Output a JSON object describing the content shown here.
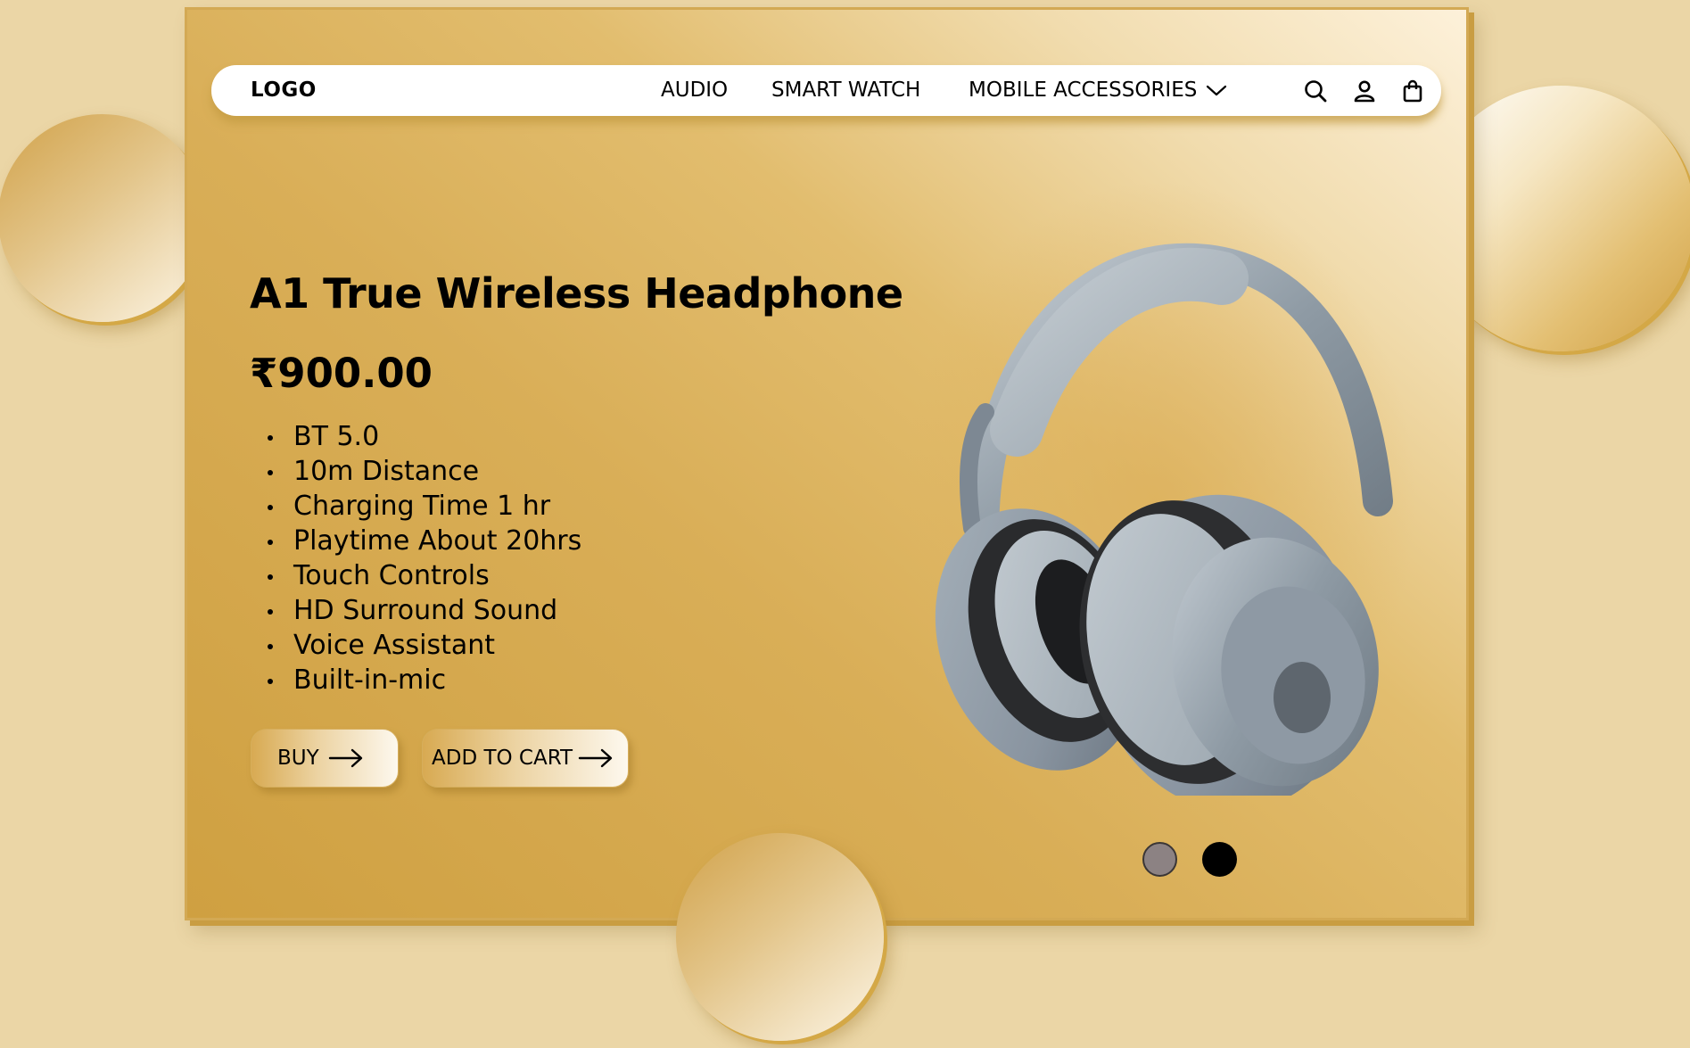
{
  "navbar": {
    "logo": "LOGO",
    "links": [
      "AUDIO",
      "SMART WATCH",
      "MOBILE ACCESSORIES"
    ],
    "icons": [
      "search-icon",
      "user-icon",
      "shopping-bag-icon"
    ]
  },
  "product": {
    "title": "A1 True Wireless Headphone",
    "price": "₹900.00",
    "features": [
      "BT 5.0",
      "10m Distance",
      "Charging Time 1 hr",
      "Playtime About 20hrs",
      "Touch Controls",
      "HD Surround Sound",
      "Voice Assistant",
      "Built-in-mic"
    ],
    "image": "headphone-image"
  },
  "actions": {
    "buy_label": "BUY",
    "cart_label": "ADD TO CART"
  },
  "carousel": {
    "dot_count": 2,
    "active_index": 1
  },
  "colors": {
    "background": "#ebd6a6",
    "gold": "#d4a846",
    "text": "#000000"
  }
}
